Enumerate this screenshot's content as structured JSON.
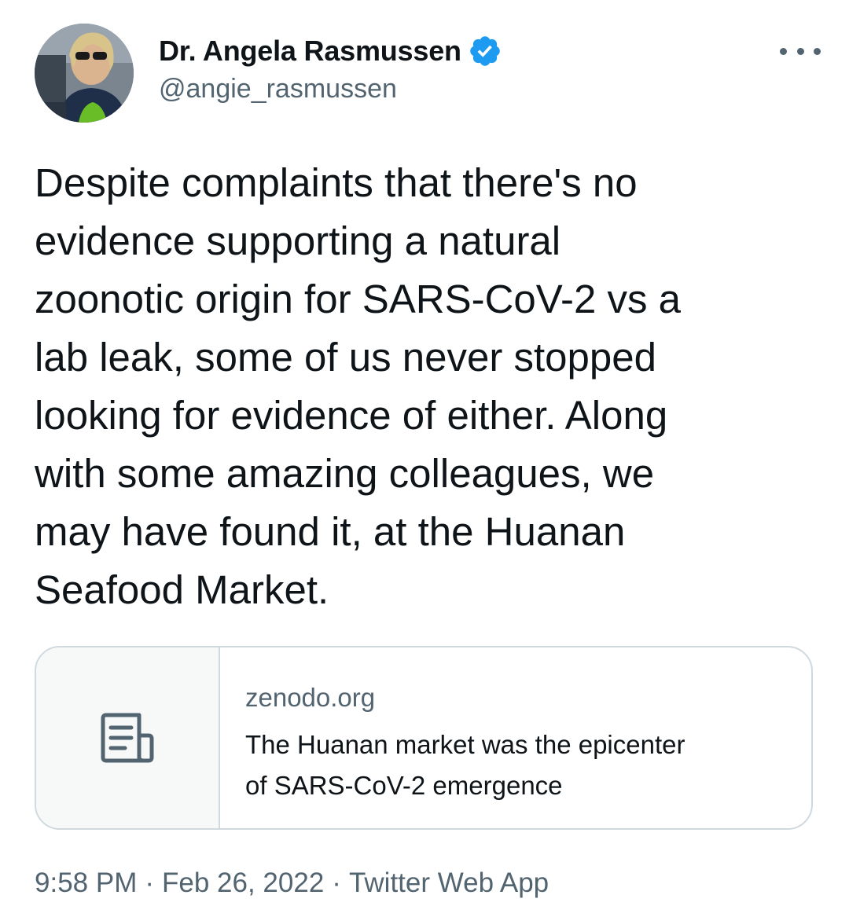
{
  "author": {
    "display_name": "Dr. Angela Rasmussen",
    "handle": "@angie_rasmussen",
    "verified": true,
    "verified_color": "#1d9bf0"
  },
  "icons": {
    "avatar": "profile-photo",
    "verified": "verified-badge-icon",
    "more": "more-options-icon",
    "card": "document-icon"
  },
  "tweet": {
    "text": "Despite complaints that there's no\nevidence supporting a natural\nzoonotic origin for SARS-CoV-2 vs a\nlab leak, some of us never stopped\nlooking for evidence of either. Along\nwith some amazing colleagues, we\nmay have found it, at the Huanan\nSeafood Market."
  },
  "link_card": {
    "domain": "zenodo.org",
    "title": "The Huanan market was the epicenter\nof SARS-CoV-2 emergence"
  },
  "meta": {
    "time": "9:58 PM",
    "date": "Feb 26, 2022",
    "source": "Twitter Web App",
    "separator": "·"
  },
  "colors": {
    "text_primary": "#0f1419",
    "text_secondary": "#536471",
    "border": "#cfd9de",
    "card_thumb_bg": "#f7f9f9"
  }
}
